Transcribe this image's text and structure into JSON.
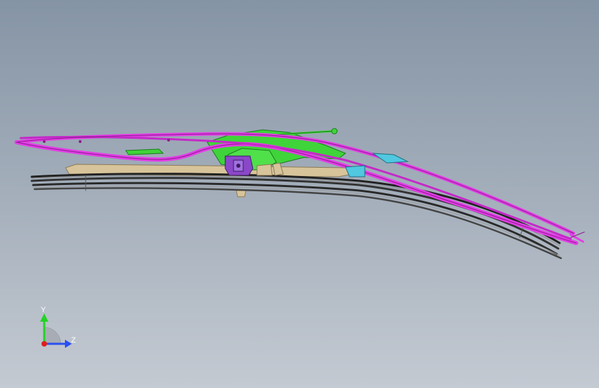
{
  "viewport": {
    "background_top": "#8594a5",
    "background_bottom": "#c4cad2"
  },
  "model": {
    "name": "wiper-blade-assembly",
    "colors": {
      "frame": "#e23ee6",
      "frame_dark": "#8a1a8c",
      "arm": "#3fd43a",
      "arm_dark": "#1b7a1c",
      "blade": "#2a2a2a",
      "blade_light": "#7a7a7a",
      "spoiler": "#d8c49a",
      "clip": "#8a48c8",
      "end_cap": "#4fc8e0"
    }
  },
  "triad": {
    "y_label": "Y",
    "z_label": "Z",
    "colors": {
      "y": "#23d323",
      "z": "#2a4ff0",
      "x": "#e01e1e"
    }
  }
}
